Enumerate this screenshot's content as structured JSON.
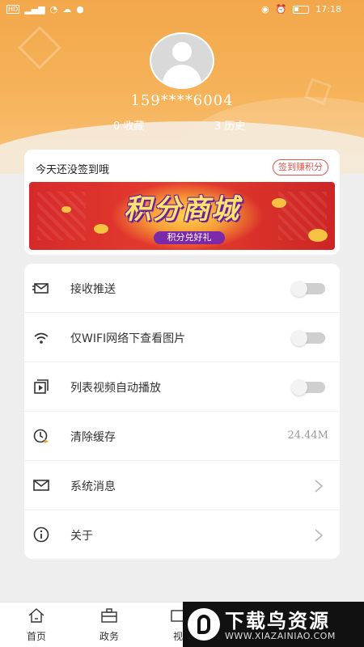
{
  "status_bar": {
    "left_text": "HD",
    "time": "17:18"
  },
  "profile": {
    "phone": "159****6004",
    "favorites": "0 收藏",
    "history": "3 历史"
  },
  "signin": {
    "prompt": "今天还没签到哦",
    "button_label": "签到赚积分",
    "banner_title": "积分商城",
    "banner_subtitle": "积分兑好礼"
  },
  "settings": [
    {
      "label": "接收推送",
      "icon": "push-notification-icon",
      "control": "toggle",
      "on": false
    },
    {
      "label": "仅WIFI网络下查看图片",
      "icon": "wifi-icon",
      "control": "toggle",
      "on": false
    },
    {
      "label": "列表视频自动播放",
      "icon": "video-play-icon",
      "control": "toggle",
      "on": false
    },
    {
      "label": "清除缓存",
      "icon": "clock-clear-icon",
      "control": "value",
      "value": "24.44M"
    },
    {
      "label": "系统消息",
      "icon": "mail-icon",
      "control": "chevron"
    },
    {
      "label": "关于",
      "icon": "info-icon",
      "control": "chevron"
    }
  ],
  "bottom_nav": [
    {
      "label": "首页",
      "icon": "home-icon"
    },
    {
      "label": "政务",
      "icon": "briefcase-icon"
    },
    {
      "label": "视",
      "icon": "video-icon"
    }
  ],
  "watermark": {
    "title": "下载鸟资源",
    "url": "WWW.XIAZAINIAO.COM"
  },
  "colors": {
    "header": "#f6b35a",
    "accent_red": "#e1564c",
    "banner_red": "#e63d2e"
  }
}
